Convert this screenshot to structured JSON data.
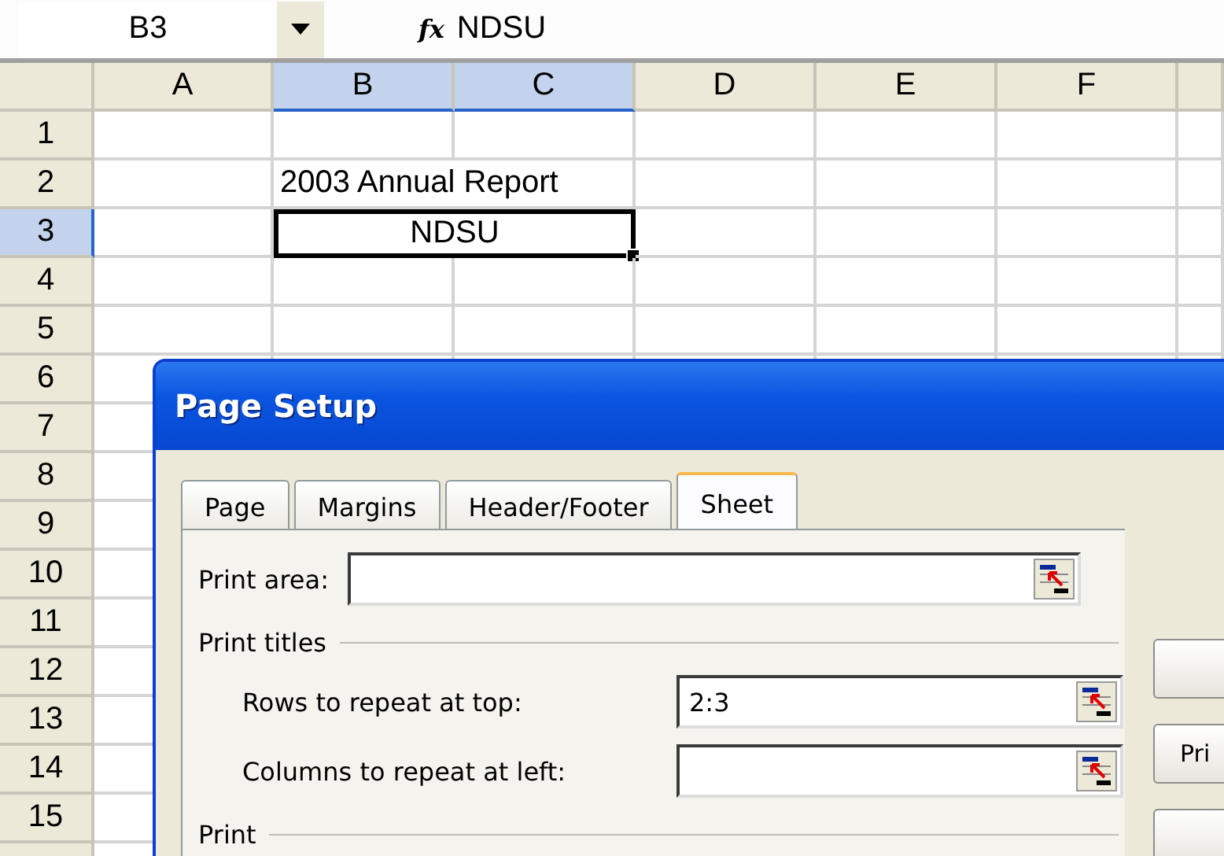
{
  "formula_bar": {
    "name_box": "B3",
    "formula": "NDSU",
    "function_label": "fx"
  },
  "sheet": {
    "columns": [
      {
        "label": "A",
        "selected": false
      },
      {
        "label": "B",
        "selected": true
      },
      {
        "label": "C",
        "selected": true
      },
      {
        "label": "D",
        "selected": false
      },
      {
        "label": "E",
        "selected": false
      },
      {
        "label": "F",
        "selected": false
      }
    ],
    "rows": [
      {
        "label": "1",
        "selected": false
      },
      {
        "label": "2",
        "selected": false,
        "cell": {
          "text": "2003 Annual Report",
          "merged": false,
          "active": false
        }
      },
      {
        "label": "3",
        "selected": true,
        "cell": {
          "text": "NDSU",
          "merged": true,
          "active": true
        }
      },
      {
        "label": "4",
        "selected": false
      },
      {
        "label": "5",
        "selected": false
      },
      {
        "label": "6",
        "selected": false
      },
      {
        "label": "7",
        "selected": false
      },
      {
        "label": "8",
        "selected": false
      },
      {
        "label": "9",
        "selected": false
      },
      {
        "label": "10",
        "selected": false
      },
      {
        "label": "11",
        "selected": false
      },
      {
        "label": "12",
        "selected": false
      },
      {
        "label": "13",
        "selected": false
      },
      {
        "label": "14",
        "selected": false
      },
      {
        "label": "15",
        "selected": false
      }
    ]
  },
  "dialog": {
    "title": "Page Setup",
    "tabs": [
      {
        "label": "Page",
        "selected": false
      },
      {
        "label": "Margins",
        "selected": false
      },
      {
        "label": "Header/Footer",
        "selected": false
      },
      {
        "label": "Sheet",
        "selected": true
      }
    ],
    "print_area": {
      "label": "Print area:"
    },
    "print_titles": {
      "heading": "Print titles",
      "fields": [
        {
          "label": "Rows to repeat at top:",
          "value": "2:3"
        },
        {
          "label": "Columns to repeat at left:"
        }
      ]
    },
    "print_section": {
      "heading": "Print"
    },
    "buttons": [
      {
        "kind": "blank"
      },
      {
        "kind": "text",
        "label": "Pri"
      },
      {
        "kind": "blank"
      }
    ]
  }
}
